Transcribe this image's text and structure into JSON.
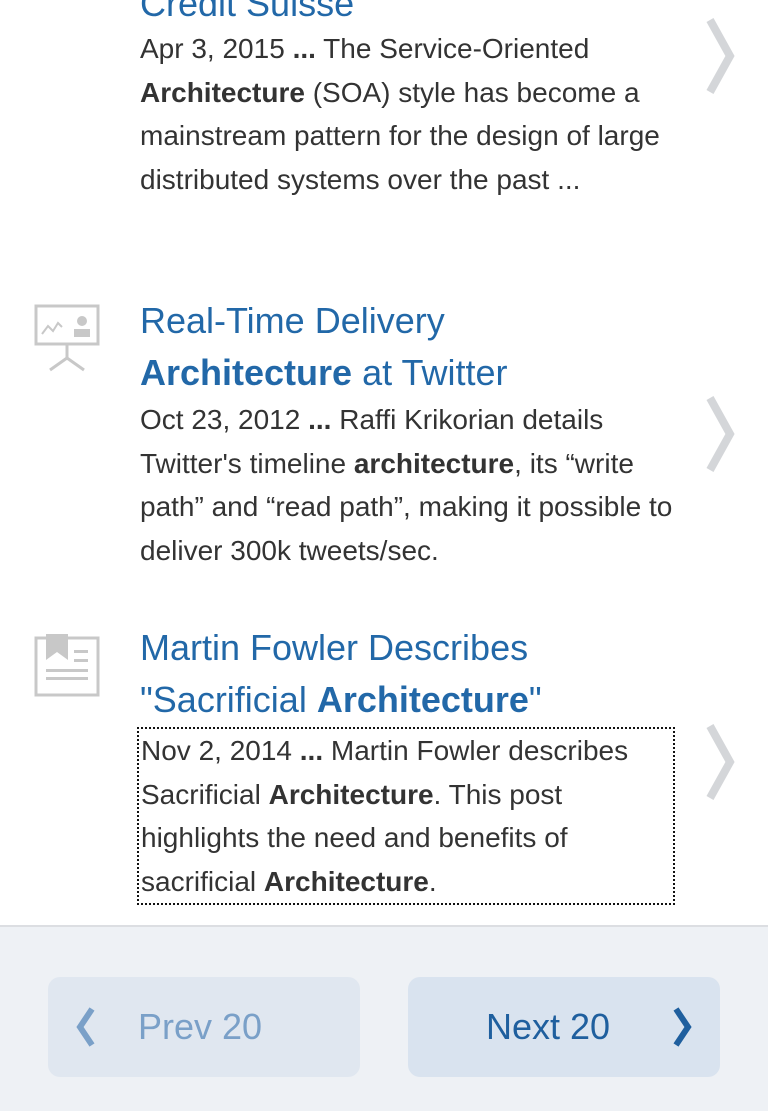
{
  "results": [
    {
      "title_parts": [
        "Credit Suisse"
      ],
      "date": "Apr 3, 2015",
      "ellipsis": "...",
      "snippet_parts": [
        " The Service-Oriented ",
        "Architecture",
        " (SOA) style has become a mainstream pattern for the design of large distributed systems over the past ..."
      ],
      "icon": "none"
    },
    {
      "title_parts": [
        "Real-Time Delivery ",
        "Architecture",
        " at Twitter"
      ],
      "date": "Oct 23, 2012",
      "ellipsis": "...",
      "snippet_parts": [
        " Raffi Krikorian details Twitter's timeline ",
        "architecture",
        ", its “write path” and “read path”, making it possible to deliver 300k tweets/sec."
      ],
      "icon": "presentation-icon"
    },
    {
      "title_parts": [
        "Martin Fowler Describes \"Sacrificial ",
        "Architecture",
        "\""
      ],
      "date": "Nov 2, 2014",
      "ellipsis": "...",
      "snippet_parts": [
        " Martin Fowler describes Sacrificial ",
        "Architecture",
        ". This post highlights the need and benefits of sacrificial ",
        "Architecture",
        "."
      ],
      "icon": "article-icon"
    }
  ],
  "pager": {
    "prev_label": "Prev 20",
    "next_label": "Next 20"
  },
  "colors": {
    "link": "#2268a8",
    "text": "#333333",
    "chevron": "#d4d6d9",
    "footer_bg": "#eef1f5"
  }
}
